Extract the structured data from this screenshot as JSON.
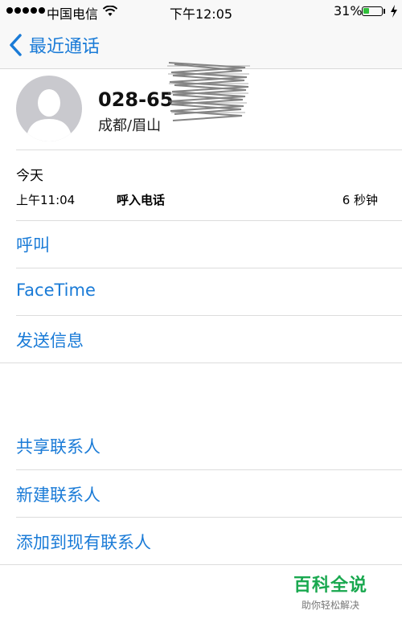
{
  "status_bar": {
    "carrier": "中国电信",
    "time": "下午12:05",
    "battery": "31%",
    "battery_level": 0.31
  },
  "nav": {
    "back_label": "最近通话"
  },
  "contact": {
    "number": "028-65",
    "location": "成都/眉山"
  },
  "call_info": {
    "date": "今天",
    "time": "上午11:04",
    "type": "呼入电话",
    "duration": "6 秒钟"
  },
  "actions": {
    "call": "呼叫",
    "facetime": "FaceTime",
    "message": "发送信息",
    "share": "共享联系人",
    "new_contact": "新建联系人",
    "add_existing": "添加到现有联系人"
  },
  "watermark": {
    "title": "百科全说",
    "subtitle": "助你轻松解决"
  },
  "colors": {
    "accent": "#1a7bd7",
    "battery": "#30c03a"
  }
}
